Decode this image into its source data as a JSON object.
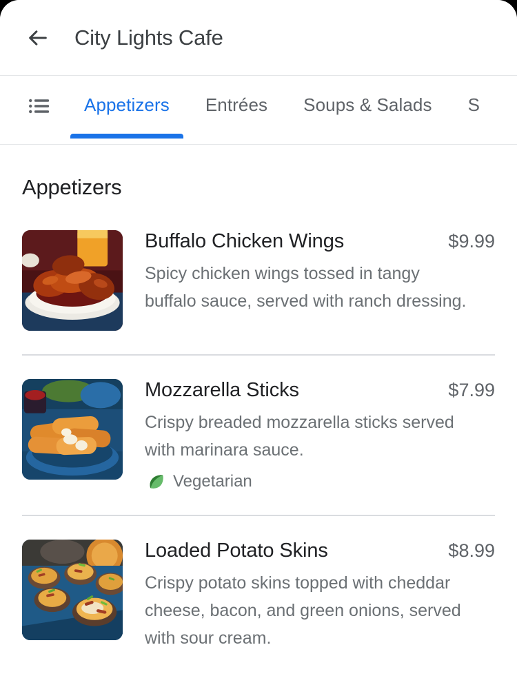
{
  "header": {
    "back_icon": "arrow-left-icon",
    "title": "City Lights Cafe"
  },
  "tabs": {
    "menu_icon": "list-icon",
    "items": [
      {
        "label": "Appetizers",
        "active": true
      },
      {
        "label": "Entrées",
        "active": false
      },
      {
        "label": "Soups & Salads",
        "active": false
      },
      {
        "label": "S",
        "active": false
      }
    ]
  },
  "section": {
    "title": "Appetizers"
  },
  "menu_items": [
    {
      "name": "Buffalo Chicken Wings",
      "price": "$9.99",
      "description": "Spicy chicken wings tossed in tangy buffalo sauce, served with ranch dressing.",
      "image_alt": "buffalo-chicken-wings-photo",
      "tags": []
    },
    {
      "name": "Mozzarella Sticks",
      "price": "$7.99",
      "description": "Crispy breaded mozzarella sticks served with marinara sauce.",
      "image_alt": "mozzarella-sticks-photo",
      "tags": [
        {
          "label": "Vegetarian",
          "icon": "leaf-icon"
        }
      ]
    },
    {
      "name": "Loaded Potato Skins",
      "price": "$8.99",
      "description": "Crispy potato skins topped with cheddar cheese, bacon, and green onions, served with sour cream.",
      "image_alt": "loaded-potato-skins-photo",
      "tags": []
    }
  ],
  "colors": {
    "accent": "#1a73e8",
    "title": "#202124",
    "secondary_text": "#5f6368",
    "description_text": "#6b7074",
    "divider": "#dadce0",
    "leaf_dark": "#2e7d32",
    "leaf_light": "#66bb6a"
  }
}
